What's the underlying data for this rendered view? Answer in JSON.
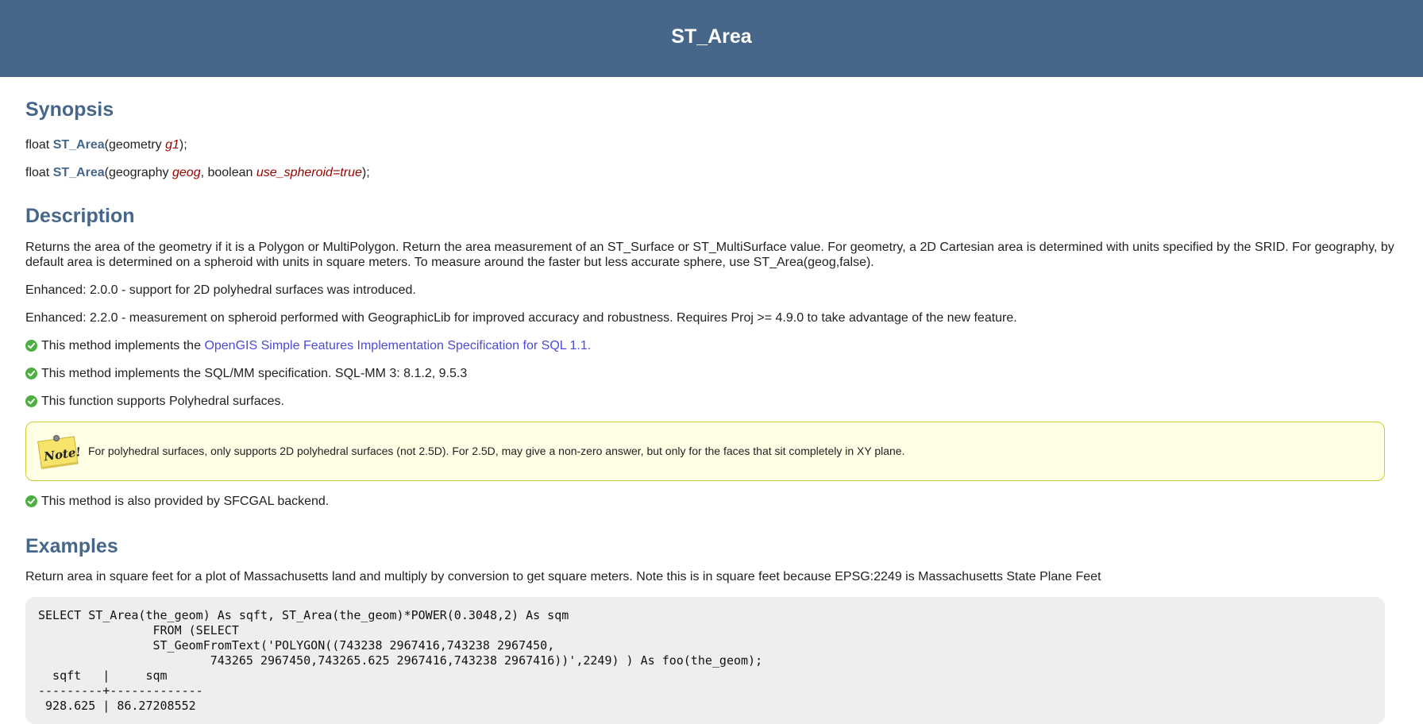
{
  "header": {
    "title": "ST_Area"
  },
  "synopsis": {
    "heading": "Synopsis",
    "sig1": {
      "ret": "float ",
      "fn": "ST_Area",
      "open": "(geometry ",
      "p1": "g1",
      "close": ");"
    },
    "sig2": {
      "ret": "float ",
      "fn": "ST_Area",
      "open": "(geography ",
      "p1": "geog",
      "mid": ", boolean ",
      "p2": "use_spheroid=true",
      "close": ");"
    }
  },
  "description": {
    "heading": "Description",
    "text": "Returns the area of the geometry if it is a Polygon or MultiPolygon. Return the area measurement of an ST_Surface or ST_MultiSurface value. For geometry, a 2D Cartesian area is determined with units specified by the SRID. For geography, by default area is determined on a spheroid with units in square meters. To measure around the faster but less accurate sphere, use ST_Area(geog,false).",
    "enhanced1": "Enhanced: 2.0.0 - support for 2D polyhedral surfaces was introduced.",
    "enhanced2": "Enhanced: 2.2.0 - measurement on spheroid performed with GeographicLib for improved accuracy and robustness. Requires Proj >= 4.9.0 to take advantage of the new feature.",
    "check1_prefix": "This method implements the ",
    "check1_link": "OpenGIS Simple Features Implementation Specification for SQL 1.1.",
    "check2": "This method implements the SQL/MM specification. SQL-MM 3: 8.1.2, 9.5.3",
    "check3": "This function supports Polyhedral surfaces.",
    "note_text": "For polyhedral surfaces, only supports 2D polyhedral surfaces (not 2.5D). For 2.5D, may give a non-zero answer, but only for the faces that sit completely in XY plane.",
    "note_icon_label": "Note!",
    "check4": "This method is also provided by SFCGAL backend."
  },
  "examples": {
    "heading": "Examples",
    "text": "Return area in square feet for a plot of Massachusetts land and multiply by conversion to get square meters. Note this is in square feet because EPSG:2249 is Massachusetts State Plane Feet",
    "code": "SELECT ST_Area(the_geom) As sqft, ST_Area(the_geom)*POWER(0.3048,2) As sqm\n\t\tFROM (SELECT\n\t\tST_GeomFromText('POLYGON((743238 2967416,743238 2967450,\n\t\t\t743265 2967450,743265.625 2967416,743238 2967416))',2249) ) As foo(the_geom);\n  sqft   |     sqm\n---------+-------------\n 928.625 | 86.27208552"
  },
  "colors": {
    "header_bg": "#466789",
    "heading": "#466789",
    "param": "#990000",
    "link": "#4b4bd6",
    "check": "#4caf3f",
    "note_bg": "#ffffe6",
    "note_border": "#cccc33",
    "code_bg": "#eeeeee"
  }
}
